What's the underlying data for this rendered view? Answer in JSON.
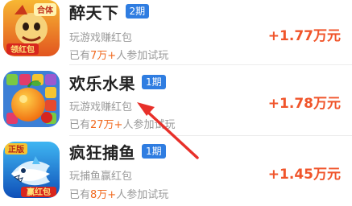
{
  "list": {
    "items": [
      {
        "title": "醉天下",
        "badge": "2期",
        "desc": "玩游戏赚红包",
        "count_prefix": "已有",
        "count": "7万+",
        "count_suffix": "人参加试玩",
        "reward": "+1.77万元",
        "icon": "zuitianxia-game-icon",
        "icon_text": [
          "合体",
          "领红包"
        ]
      },
      {
        "title": "欢乐水果",
        "badge": "1期",
        "desc": "玩游戏赚红包",
        "count_prefix": "已有",
        "count": "27万+",
        "count_suffix": "人参加试玩",
        "reward": "+1.78万元",
        "icon": "fruit-game-icon"
      },
      {
        "title": "疯狂捕鱼",
        "badge": "1期",
        "desc": "玩捕鱼赢红包",
        "count_prefix": "已有",
        "count": "8万+",
        "count_suffix": "人参加试玩",
        "reward": "+1.45万元",
        "icon": "fishing-game-icon",
        "icon_text": [
          "正版",
          "赢红包"
        ]
      }
    ]
  },
  "colors": {
    "badge_blue": "#2f7de1",
    "reward_red": "#f0552b",
    "count_orange": "#f16a1f",
    "arrow_red": "#e8302a",
    "muted_text": "#9a9a9a"
  }
}
